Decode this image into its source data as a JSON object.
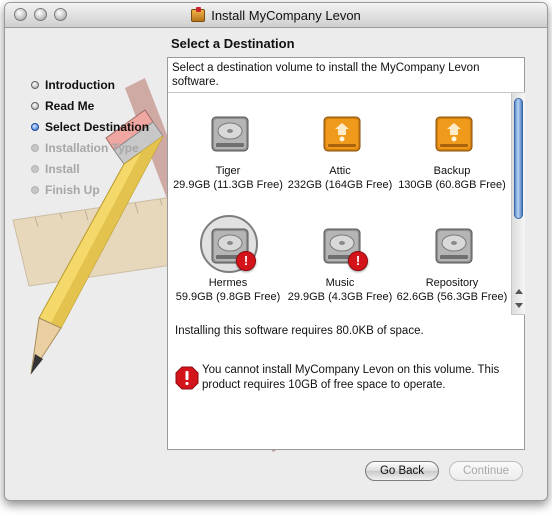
{
  "window": {
    "title": "Install MyCompany Levon"
  },
  "sidebar": {
    "steps": [
      {
        "label": "Introduction",
        "state": "done"
      },
      {
        "label": "Read Me",
        "state": "done"
      },
      {
        "label": "Select Destination",
        "state": "current"
      },
      {
        "label": "Installation Type",
        "state": "future"
      },
      {
        "label": "Install",
        "state": "future"
      },
      {
        "label": "Finish Up",
        "state": "future"
      }
    ]
  },
  "main": {
    "heading": "Select a Destination",
    "instructions": "Select a destination volume to install the MyCompany Levon software.",
    "volumes": [
      {
        "name": "Tiger",
        "size": "29.9GB (11.3GB Free)",
        "kind": "internal",
        "warning": false,
        "selected": false
      },
      {
        "name": "Attic",
        "size": "232GB (164GB Free)",
        "kind": "firewire",
        "warning": false,
        "selected": false
      },
      {
        "name": "Backup",
        "size": "130GB (60.8GB Free)",
        "kind": "firewire",
        "warning": false,
        "selected": false
      },
      {
        "name": "Hermes",
        "size": "59.9GB (9.8GB Free)",
        "kind": "internal",
        "warning": true,
        "selected": true
      },
      {
        "name": "Music",
        "size": "29.9GB (4.3GB Free)",
        "kind": "internal",
        "warning": true,
        "selected": false
      },
      {
        "name": "Repository",
        "size": "62.6GB (56.3GB Free)",
        "kind": "internal",
        "warning": false,
        "selected": false
      }
    ],
    "space_required": "Installing this software requires 80.0KB of space.",
    "warning_message": "You cannot install MyCompany Levon on this volume. This product requires 10GB of free space to operate."
  },
  "buttons": {
    "back": "Go Back",
    "continue": "Continue"
  },
  "colors": {
    "accent": "#2a6bd8",
    "warning": "#d3141b",
    "firewire_drive": "#f09a1c"
  },
  "icons": {
    "internal": "hard-drive-icon",
    "firewire": "firewire-drive-icon",
    "warning": "stop-warning-icon"
  }
}
